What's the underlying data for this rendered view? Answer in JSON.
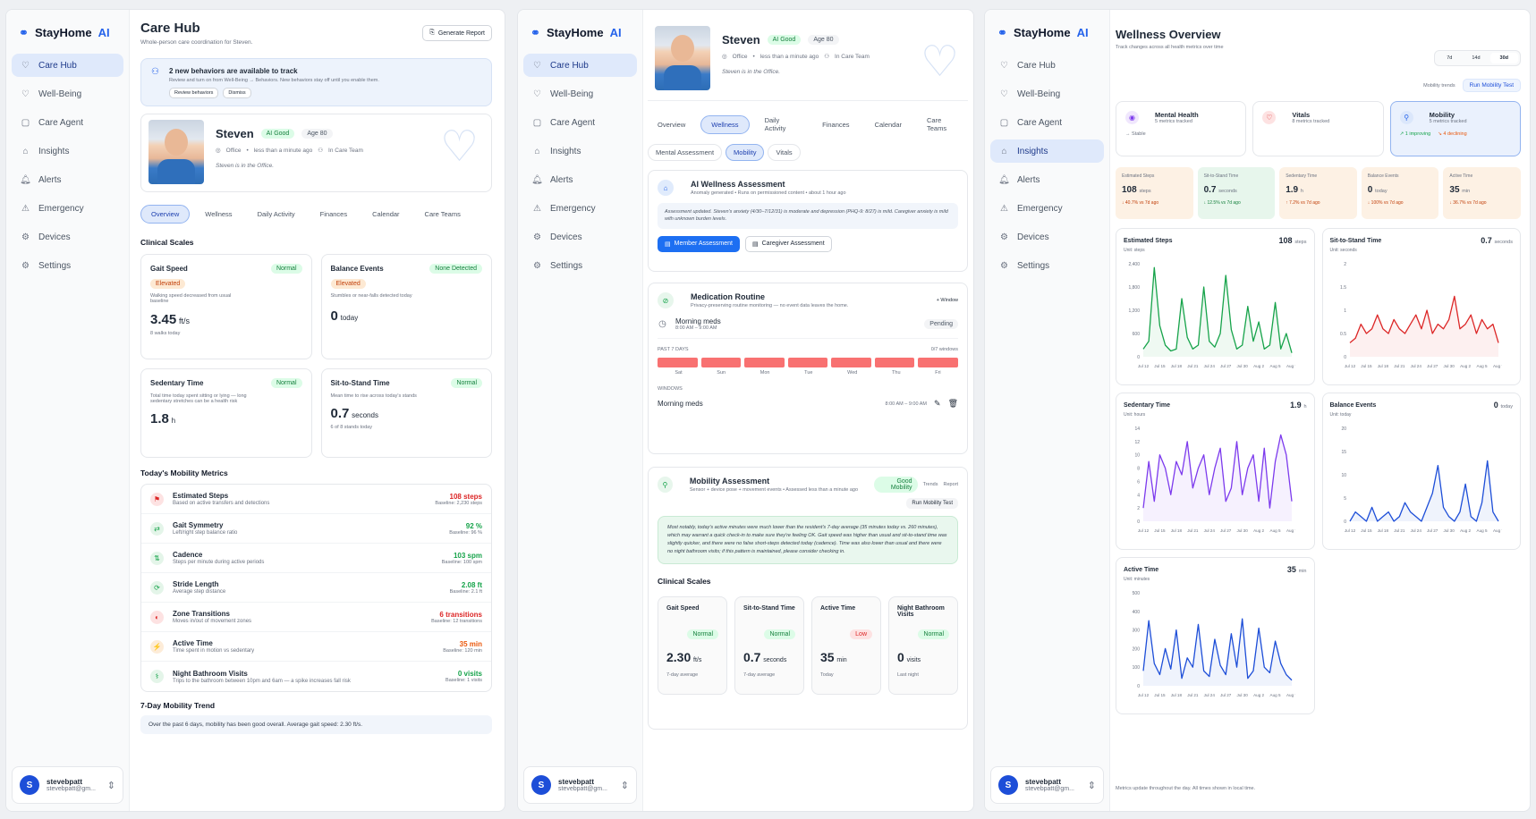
{
  "brand": {
    "name": "StayHome",
    "ai": "AI"
  },
  "nav": [
    {
      "label": "Care Hub",
      "icon": "heart-icon"
    },
    {
      "label": "Well-Being",
      "icon": "heart-pulse-icon"
    },
    {
      "label": "Care Agent",
      "icon": "robot-icon"
    },
    {
      "label": "Insights",
      "icon": "home-chart-icon"
    },
    {
      "label": "Alerts",
      "icon": "bell-icon"
    },
    {
      "label": "Emergency",
      "icon": "siren-icon"
    },
    {
      "label": "Devices",
      "icon": "device-icon"
    },
    {
      "label": "Settings",
      "icon": "gear-icon"
    }
  ],
  "user": {
    "initial": "S",
    "name": "stevebpatt",
    "email": "stevebpatt@gm..."
  },
  "p1": {
    "title": "Care Hub",
    "subtitle": "Whole-person care coordination for Steven.",
    "report_btn": "Generate Report",
    "banner": {
      "title": "2 new behaviors are available to track",
      "text": "Review and turn on from Well-Being → Behaviors. New behaviors stay off until you enable them.",
      "review": "Review behaviors",
      "dismiss": "Dismiss"
    },
    "tabs": [
      "Overview",
      "Wellness",
      "Daily Activity",
      "Finances",
      "Calendar",
      "Care Teams"
    ],
    "clinical_title": "Clinical Scales",
    "scales": [
      {
        "name": "Gait Speed",
        "status": "Normal",
        "flag": "Elevated",
        "desc": "Walking speed decreased from usual baseline",
        "value": "3.45",
        "unit": "ft/s",
        "foot": "8 walks today"
      },
      {
        "name": "Balance Events",
        "status": "None Detected",
        "flag": "Elevated",
        "desc": "Stumbles or near-falls detected today",
        "value": "0",
        "unit": "today",
        "foot": ""
      },
      {
        "name": "Sedentary Time",
        "status": "Normal",
        "flag": "",
        "desc": "Total time today spent sitting or lying — long sedentary stretches can be a health risk",
        "value": "1.8",
        "unit": "h",
        "foot": ""
      },
      {
        "name": "Sit-to-Stand Time",
        "status": "Normal",
        "flag": "",
        "desc": "Mean time to rise across today's stands",
        "value": "0.7",
        "unit": "seconds",
        "foot": "6 of 8 stands today"
      }
    ],
    "mobility_title": "Today's Mobility Metrics",
    "metrics": [
      {
        "name": "Estimated Steps",
        "desc": "Based on active transfers and detections",
        "value": "108 steps",
        "baseline": "Baseline: 2,230 steps",
        "color": "#dc2626"
      },
      {
        "name": "Gait Symmetry",
        "desc": "Left/right step balance ratio",
        "value": "92 %",
        "baseline": "Baseline: 96 %",
        "color": "#16a34a"
      },
      {
        "name": "Cadence",
        "desc": "Steps per minute during active periods",
        "value": "103 spm",
        "baseline": "Baseline: 100 spm",
        "color": "#16a34a"
      },
      {
        "name": "Stride Length",
        "desc": "Average step distance",
        "value": "2.08 ft",
        "baseline": "Baseline: 2.1 ft",
        "color": "#16a34a"
      },
      {
        "name": "Zone Transitions",
        "desc": "Moves in/out of movement zones",
        "value": "6 transitions",
        "baseline": "Baseline: 12 transitions",
        "color": "#dc2626"
      },
      {
        "name": "Active Time",
        "desc": "Time spent in motion vs sedentary",
        "value": "35 min",
        "baseline": "Baseline: 120 min",
        "color": "#ea580c"
      },
      {
        "name": "Night Bathroom Visits",
        "desc": "Trips to the bathroom between 10pm and 6am — a spike increases fall risk",
        "value": "0 visits",
        "baseline": "Baseline: 1 visits",
        "color": "#16a34a"
      }
    ],
    "trend_title": "7-Day Mobility Trend",
    "trend_text": "Over the past 6 days, mobility has been good overall. Average gait speed: 2.30 ft/s."
  },
  "profile": {
    "name": "Steven",
    "ai_badge": "AI Good",
    "age": "Age 80",
    "location": "Office",
    "time": "less than a minute ago",
    "team": "In Care Team",
    "status": "Steven is in the Office."
  },
  "p2": {
    "tabs": [
      "Overview",
      "Wellness",
      "Daily Activity",
      "Finances",
      "Calendar",
      "Care Teams"
    ],
    "subtabs": [
      "Mental Assessment",
      "Mobility",
      "Vitals"
    ],
    "ai": {
      "title": "AI Wellness Assessment",
      "meta": "Anomaly generated • Runs on permissioned content • about 1 hour ago",
      "text": "Assessment updated. Steven's anxiety (4/30–7/12/31) is moderate and depression (PHQ-9: 8/27) is mild. Caregiver anxiety is mild with unknown burden levels.",
      "btn1": "Member Assessment",
      "btn2": "Caregiver Assessment"
    },
    "med": {
      "title": "Medication Routine",
      "sub": "Privacy-preserving routine monitoring — no event data leaves the home.",
      "window_btn": "+ Window",
      "item": "Morning meds",
      "item_time": "8:00 AM – 9:00 AM",
      "pending": "Pending",
      "past": "PAST 7 DAYS",
      "count": "0/7 windows",
      "days": [
        "Sat",
        "Sun",
        "Mon",
        "Tue",
        "Wed",
        "Thu",
        "Fri"
      ],
      "windows": "WINDOWS",
      "w_name": "Morning meds",
      "w_time": "8:00 AM – 9:00 AM"
    },
    "mob": {
      "title": "Mobility Assessment",
      "badge": "Good Mobility",
      "trends": "Trends",
      "report": "Report",
      "sub": "Sensor + device pose + movement events • Assessed less than a minute ago",
      "run": "Run Mobility Test",
      "text": "Most notably, today's active minutes were much lower than the resident's 7-day average (35 minutes today vs. 260 minutes), which may warrant a quick check-in to make sure they're feeling OK. Gait speed was higher than usual and sit-to-stand time was slightly quicker, and there were no false short-steps detected today (cadence). Time was also lower than usual and there were no night bathroom visits; if this pattern is maintained, please consider checking in."
    },
    "clinical_title": "Clinical Scales",
    "scales": [
      {
        "name": "Gait Speed",
        "status": "Normal",
        "value": "2.30",
        "unit": "ft/s",
        "foot": "7-day average",
        "sc": "green"
      },
      {
        "name": "Sit-to-Stand Time",
        "status": "Normal",
        "value": "0.7",
        "unit": "seconds",
        "foot": "7-day average",
        "sc": "green"
      },
      {
        "name": "Active Time",
        "status": "Low",
        "value": "35",
        "unit": "min",
        "foot": "Today",
        "sc": "red"
      },
      {
        "name": "Night Bathroom Visits",
        "status": "Normal",
        "value": "0",
        "unit": "visits",
        "foot": "Last night",
        "sc": "green"
      }
    ]
  },
  "p3": {
    "title": "Wellness Overview",
    "subtitle": "Track changes across all health metrics over time",
    "ranges": [
      "7d",
      "14d",
      "30d"
    ],
    "trends_label": "Mobility trends",
    "run_btn": "Run Mobility Test",
    "cats": [
      {
        "name": "Mental Health",
        "sub": "5 metrics tracked",
        "note": "→ Stable",
        "note2": ""
      },
      {
        "name": "Vitals",
        "sub": "8 metrics tracked",
        "note": "",
        "note2": ""
      },
      {
        "name": "Mobility",
        "sub": "5 metrics tracked",
        "note": "↗ 1 improving",
        "note2": "↘ 4 declining"
      }
    ],
    "mini": [
      {
        "name": "Estimated Steps",
        "value": "108",
        "unit": "steps",
        "change": "↓ 40.7% vs 7d ago",
        "c": "#c2410c",
        "bg": "#fdf1e4"
      },
      {
        "name": "Sit-to-Stand Time",
        "value": "0.7",
        "unit": "seconds",
        "change": "↓ 12.5% vs 7d ago",
        "c": "#15803d",
        "bg": "#e7f6ec"
      },
      {
        "name": "Sedentary Time",
        "value": "1.9",
        "unit": "h",
        "change": "↑ 7.2% vs 7d ago",
        "c": "#c2410c",
        "bg": "#fdf1e4"
      },
      {
        "name": "Balance Events",
        "value": "0",
        "unit": "today",
        "change": "↓ 100% vs 7d ago",
        "c": "#c2410c",
        "bg": "#fdf1e4"
      },
      {
        "name": "Active Time",
        "value": "35",
        "unit": "min",
        "change": "↓ 36.7% vs 7d ago",
        "c": "#c2410c",
        "bg": "#fdf1e4"
      }
    ],
    "footer": "Metrics update throughout the day. All times shown in local time."
  },
  "chart_data": [
    {
      "type": "line",
      "title": "Estimated Steps",
      "value": "108",
      "unit": "steps",
      "ylabel": "Unit: steps",
      "color": "#16a34a",
      "yticks": [
        "2,400",
        "1,800",
        "1,200",
        "600",
        "0"
      ],
      "ylim": [
        0,
        2400
      ],
      "x": [
        "Jul 12",
        "Jul 15",
        "Jul 18",
        "Jul 21",
        "Jul 24",
        "Jul 27",
        "Jul 30",
        "Aug 2",
        "Aug 5",
        "Aug 7"
      ],
      "values": [
        200,
        400,
        2300,
        800,
        300,
        150,
        200,
        1500,
        500,
        200,
        300,
        1800,
        400,
        250,
        600,
        2100,
        700,
        200,
        300,
        1300,
        400,
        900,
        200,
        300,
        1400,
        200,
        600,
        100
      ]
    },
    {
      "type": "line",
      "title": "Sit-to-Stand Time",
      "value": "0.7",
      "unit": "seconds",
      "ylabel": "Unit: seconds",
      "color": "#dc2626",
      "yticks": [
        "2",
        "1.5",
        "1",
        "0.5",
        "0"
      ],
      "ylim": [
        0,
        2
      ],
      "x": [
        "Jul 12",
        "Jul 15",
        "Jul 18",
        "Jul 21",
        "Jul 24",
        "Jul 27",
        "Jul 30",
        "Aug 2",
        "Aug 5",
        "Aug 7"
      ],
      "values": [
        0.3,
        0.4,
        0.7,
        0.5,
        0.6,
        0.9,
        0.6,
        0.5,
        0.8,
        0.6,
        0.5,
        0.7,
        0.9,
        0.6,
        1.0,
        0.5,
        0.7,
        0.6,
        0.8,
        1.3,
        0.6,
        0.7,
        0.9,
        0.5,
        0.8,
        0.6,
        0.7,
        0.3
      ]
    },
    {
      "type": "line",
      "title": "Sedentary Time",
      "value": "1.9",
      "unit": "h",
      "ylabel": "Unit: hours",
      "color": "#7c3aed",
      "yticks": [
        "14",
        "12",
        "10",
        "8",
        "6",
        "4",
        "2",
        "0"
      ],
      "ylim": [
        0,
        14
      ],
      "x": [
        "Jul 12",
        "Jul 15",
        "Jul 18",
        "Jul 21",
        "Jul 24",
        "Jul 27",
        "Jul 30",
        "Aug 2",
        "Aug 5",
        "Aug 7"
      ],
      "values": [
        2,
        9,
        3,
        10,
        8,
        4,
        9,
        7,
        12,
        5,
        8,
        10,
        4,
        8,
        11,
        3,
        5,
        12,
        4,
        8,
        10,
        3,
        11,
        2,
        9,
        13,
        10,
        3
      ]
    },
    {
      "type": "line",
      "title": "Balance Events",
      "value": "0",
      "unit": "today",
      "ylabel": "Unit: today",
      "color": "#1d4ed8",
      "yticks": [
        "20",
        "15",
        "10",
        "5",
        "0"
      ],
      "ylim": [
        0,
        20
      ],
      "x": [
        "Jul 12",
        "Jul 15",
        "Jul 18",
        "Jul 21",
        "Jul 24",
        "Jul 27",
        "Jul 30",
        "Aug 2",
        "Aug 5",
        "Aug 7"
      ],
      "values": [
        0,
        2,
        1,
        0,
        3,
        0,
        1,
        2,
        0,
        1,
        4,
        2,
        1,
        0,
        3,
        6,
        12,
        3,
        1,
        0,
        2,
        8,
        1,
        0,
        4,
        13,
        2,
        0
      ]
    },
    {
      "type": "line",
      "title": "Active Time",
      "value": "35",
      "unit": "min",
      "ylabel": "Unit: minutes",
      "color": "#1d4ed8",
      "yticks": [
        "500",
        "400",
        "300",
        "200",
        "100",
        "0"
      ],
      "ylim": [
        0,
        500
      ],
      "x": [
        "Jul 12",
        "Jul 15",
        "Jul 18",
        "Jul 21",
        "Jul 24",
        "Jul 27",
        "Jul 30",
        "Aug 2",
        "Aug 5",
        "Aug 7"
      ],
      "values": [
        80,
        350,
        120,
        60,
        200,
        90,
        300,
        40,
        150,
        100,
        330,
        80,
        50,
        250,
        110,
        60,
        280,
        100,
        360,
        40,
        80,
        310,
        100,
        70,
        240,
        120,
        60,
        30
      ]
    }
  ]
}
